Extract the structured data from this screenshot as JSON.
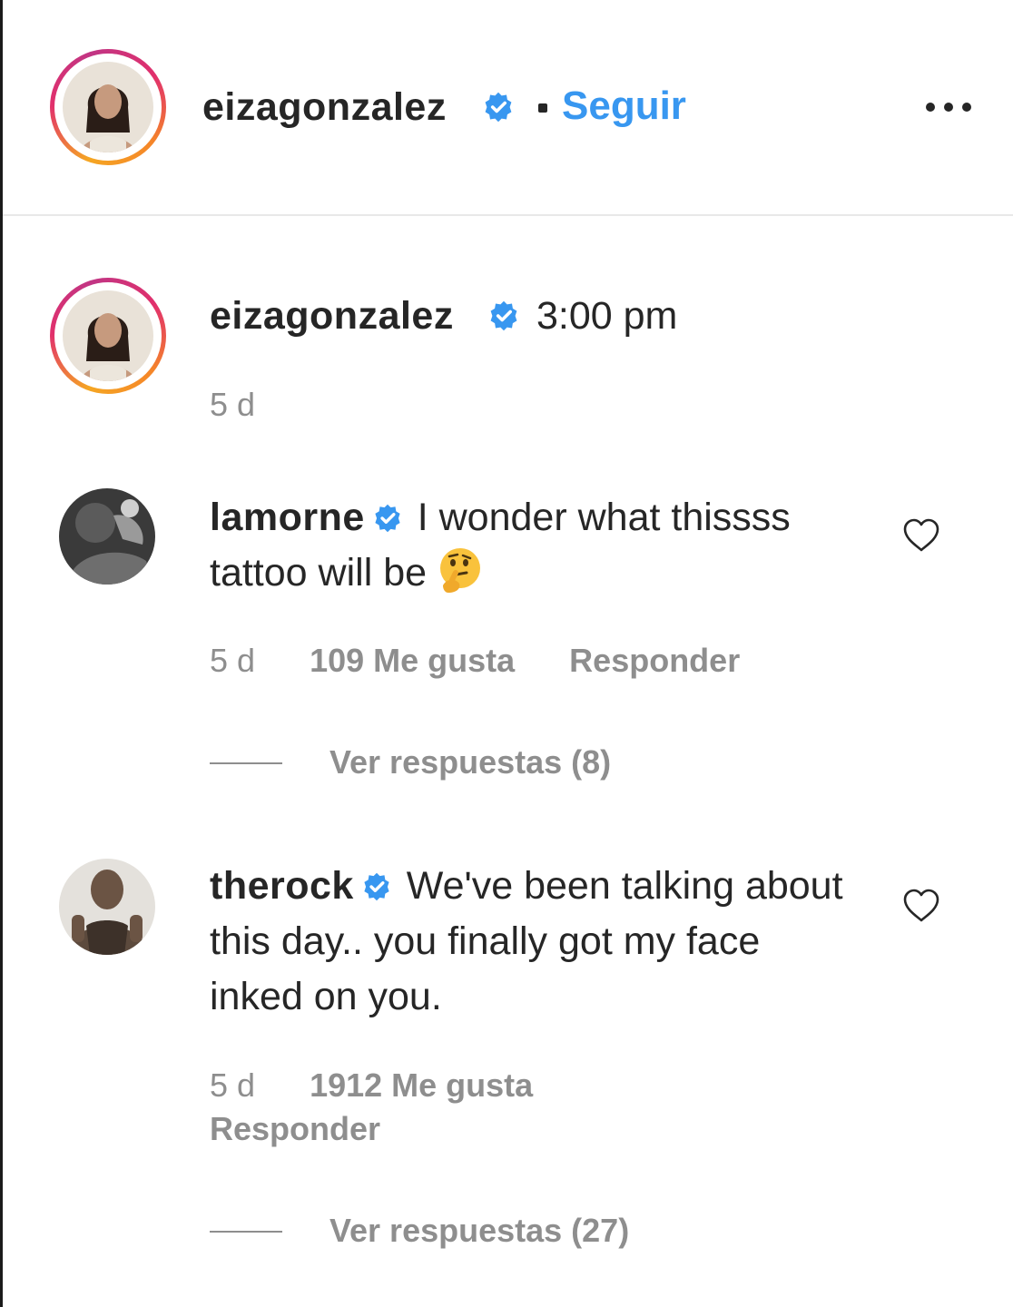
{
  "post_header": {
    "username": "eizagonzalez",
    "separator": "•",
    "follow_label": "Seguir",
    "more_icon": "more-horizontal-icon"
  },
  "caption": {
    "username": "eizagonzalez",
    "text": "3:00 pm",
    "age": "5 d"
  },
  "comments": [
    {
      "username": "lamorne",
      "text": "I wonder what thissss tattoo will be",
      "emoji": "thinking-face-emoji",
      "age": "5 d",
      "likes": "109 Me gusta",
      "reply_label": "Responder",
      "view_replies": "Ver respuestas (8)"
    },
    {
      "username": "therock",
      "text": "We've been talking about this day.. you finally got my face inked on you.",
      "age": "5 d",
      "likes": "1912 Me gusta",
      "reply_label": "Responder",
      "view_replies": "Ver respuestas (27)"
    }
  ],
  "colors": {
    "text": "#262626",
    "secondary": "#8e8e8e",
    "link_blue": "#3897f0",
    "verified_blue": "#3897f0",
    "divider": "#e8e8e8"
  }
}
